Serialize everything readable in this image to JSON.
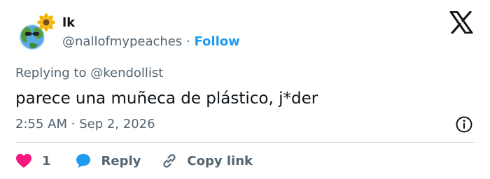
{
  "user": {
    "display_name": "lk",
    "handle": "@nallofmypeaches",
    "separator": "·",
    "follow_label": "Follow"
  },
  "tweet": {
    "replying_prefix": "Replying to",
    "replying_to": "@kendollist",
    "text": "parece una muñeca de plástico, j*der",
    "time": "2:55 AM",
    "date_separator": "·",
    "date": "Sep 2, 2026"
  },
  "actions": {
    "like_count": "1",
    "reply_label": "Reply",
    "copy_label": "Copy link"
  },
  "icons": {
    "logo": "x-logo-icon",
    "info": "info-icon",
    "like": "heart-icon",
    "reply": "speech-bubble-icon",
    "copy": "link-icon"
  },
  "colors": {
    "accent": "#1d9bf0",
    "like": "#f91880",
    "secondary_text": "#536471",
    "primary_text": "#0f1419",
    "divider": "#cfd9de"
  }
}
